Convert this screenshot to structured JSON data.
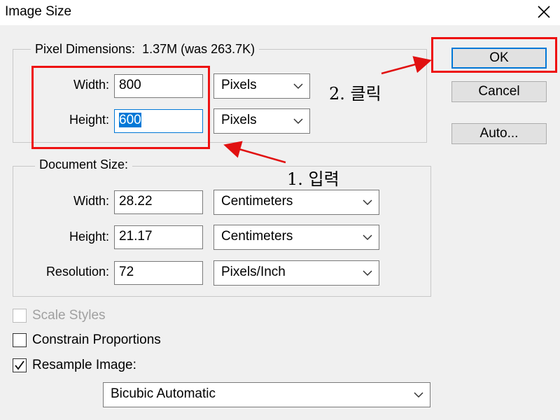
{
  "window": {
    "title": "Image Size"
  },
  "pixel_dimensions": {
    "legend": "Pixel Dimensions:",
    "size_info": "1.37M (was 263.7K)",
    "width_label": "Width:",
    "width_value": "800",
    "width_unit": "Pixels",
    "height_label": "Height:",
    "height_value": "600",
    "height_unit": "Pixels"
  },
  "document_size": {
    "legend": "Document Size:",
    "width_label": "Width:",
    "width_value": "28.22",
    "width_unit": "Centimeters",
    "height_label": "Height:",
    "height_value": "21.17",
    "height_unit": "Centimeters",
    "resolution_label": "Resolution:",
    "resolution_value": "72",
    "resolution_unit": "Pixels/Inch"
  },
  "buttons": {
    "ok": "OK",
    "cancel": "Cancel",
    "auto": "Auto..."
  },
  "options": {
    "scale_styles": {
      "label": "Scale Styles",
      "checked": false,
      "enabled": false
    },
    "constrain_proportions": {
      "label": "Constrain Proportions",
      "checked": false
    },
    "resample_image": {
      "label": "Resample Image:",
      "checked": true
    },
    "resample_method": "Bicubic Automatic"
  },
  "annotations": {
    "step1": "1. 입력",
    "step2": "2. 클릭",
    "color": "#e11111"
  },
  "colors": {
    "selection": "#0078d7",
    "dialog_bg": "#f0f0f0"
  }
}
